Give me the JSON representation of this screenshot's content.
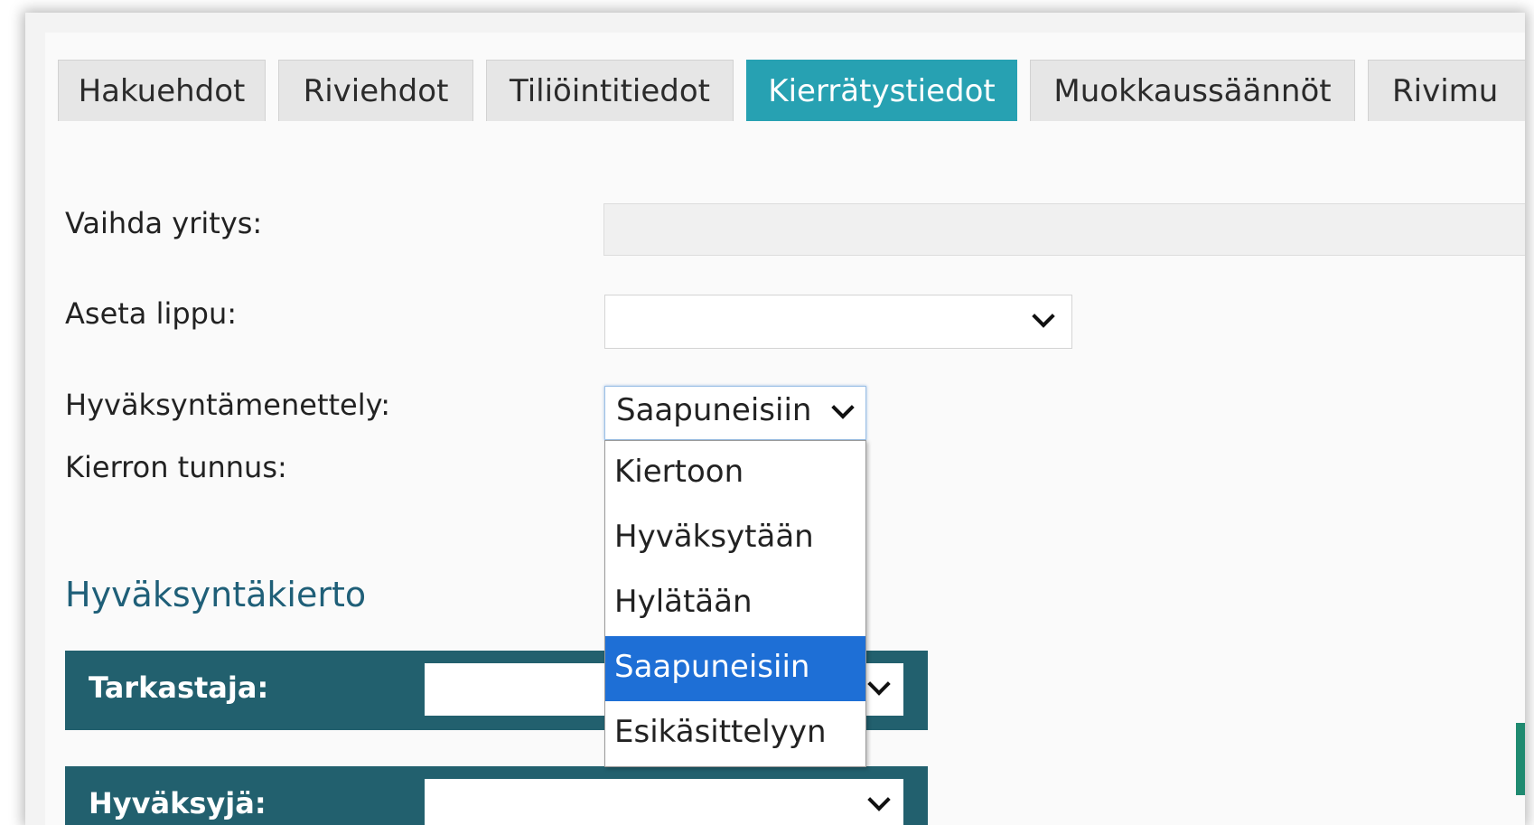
{
  "tabs": [
    {
      "label": "Hakuehdot"
    },
    {
      "label": "Riviehdot"
    },
    {
      "label": "Tiliöintitiedot"
    },
    {
      "label": "Kierrätystiedot"
    },
    {
      "label": "Muokkaussäännöt"
    },
    {
      "label": "Rivimu"
    }
  ],
  "active_tab": "Kierrätystiedot",
  "form": {
    "change_company_label": "Vaihda yritys:",
    "change_company_value": "",
    "set_flag_label": "Aseta lippu:",
    "set_flag_value": "",
    "approval_procedure_label": "Hyväksyntämenettely:",
    "approval_procedure_value": "Saapuneisiin",
    "circulation_id_label": "Kierron tunnus:"
  },
  "approval_procedure_options": [
    "Kiertoon",
    "Hyväksytään",
    "Hylätään",
    "Saapuneisiin",
    "Esikäsittelyyn"
  ],
  "section": {
    "title": "Hyväksyntäkierto",
    "reviewer_label": "Tarkastaja:",
    "approver_label": "Hyväksyjä:"
  },
  "colors": {
    "active_tab": "#27a1b2",
    "role_bar": "#22606e",
    "selected_option": "#1e6fd6",
    "section_title": "#1f5f78"
  }
}
